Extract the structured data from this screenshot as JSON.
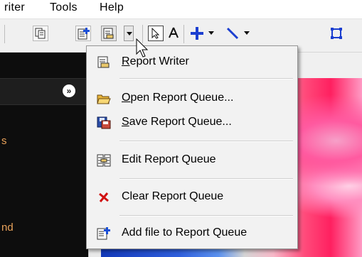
{
  "menubar": {
    "items": [
      {
        "label": "riter"
      },
      {
        "label": "Tools"
      },
      {
        "label": "Help"
      }
    ]
  },
  "toolbar": {
    "buttons": [
      {
        "name": "copy-icon"
      },
      {
        "name": "add-report-icon"
      },
      {
        "name": "report-writer-icon"
      },
      {
        "name": "pointer-icon"
      },
      {
        "name": "text-icon"
      },
      {
        "name": "crosshair-icon"
      },
      {
        "name": "line-tool-icon"
      },
      {
        "name": "rectangle-tool-icon"
      }
    ]
  },
  "left_panel": {
    "collapse_glyph": "»",
    "label_mid": "s",
    "label_bottom": "nd"
  },
  "menu": {
    "items": [
      {
        "mnemonic": "R",
        "rest": "eport Writer",
        "icon": "report-writer-icon"
      },
      {
        "mnemonic": "O",
        "rest": "pen Report Queue...",
        "icon": "open-folder-icon"
      },
      {
        "mnemonic": "S",
        "rest": "ave Report Queue...",
        "icon": "save-disk-icon"
      },
      {
        "label": "Edit Report Queue",
        "icon": "edit-queue-icon"
      },
      {
        "label": "Clear Report Queue",
        "icon": "clear-x-icon"
      },
      {
        "label": "Add file to Report Queue",
        "icon": "add-file-icon"
      }
    ]
  },
  "colors": {
    "menu_bg": "#f2f2f2",
    "panel_bg": "#0d0d0d",
    "panel_label": "#e8a25a",
    "clear_icon": "#d01010"
  }
}
